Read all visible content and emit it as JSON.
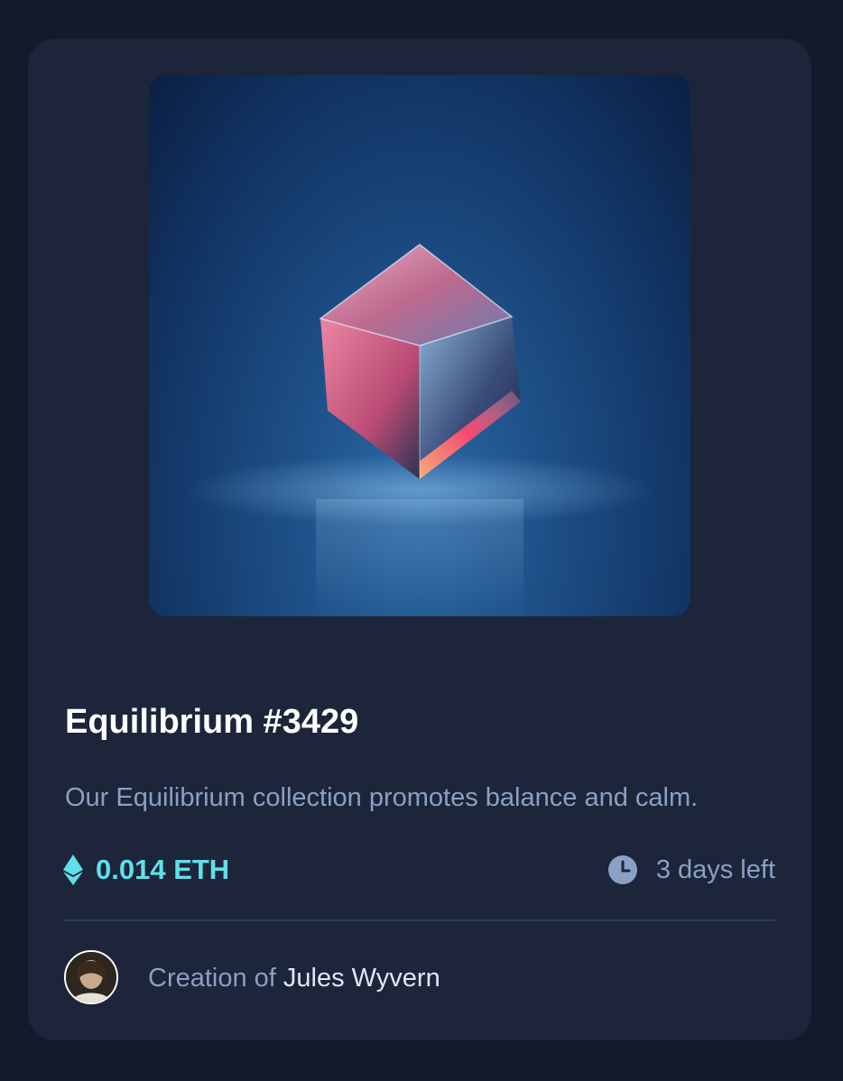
{
  "card": {
    "title": "Equilibrium #3429",
    "description": "Our Equilibrium collection promotes balance and calm.",
    "price": "0.014 ETH",
    "time_left": "3 days left",
    "creator_prefix": "Creation of",
    "creator_name": "Jules Wyvern"
  },
  "icons": {
    "price": "ethereum-icon",
    "time": "clock-icon"
  },
  "colors": {
    "background": "#131a2b",
    "card": "#1c2539",
    "accent": "#5fe0ea",
    "muted_text": "#8aa0c4",
    "title": "#ffffff"
  }
}
